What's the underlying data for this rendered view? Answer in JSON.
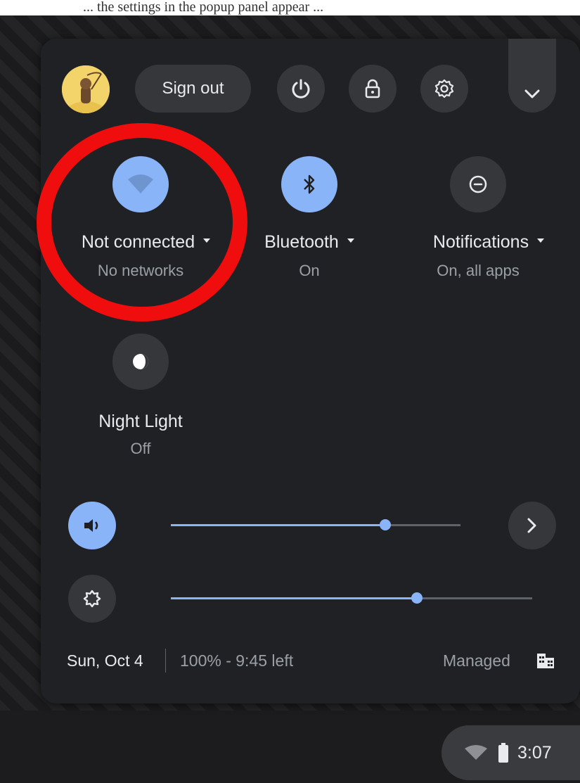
{
  "caption": "... the settings in the popup panel appear ...",
  "header": {
    "sign_out_label": "Sign out"
  },
  "tiles": {
    "network": {
      "label": "Not connected",
      "sub": "No networks",
      "active": true
    },
    "bluetooth": {
      "label": "Bluetooth",
      "sub": "On",
      "active": true
    },
    "notifications": {
      "label": "Notifications",
      "sub": "On, all apps",
      "active": false
    },
    "night_light": {
      "label": "Night Light",
      "sub": "Off",
      "active": false
    }
  },
  "sliders": {
    "volume": {
      "level": 0.74
    },
    "brightness": {
      "level": 0.68
    }
  },
  "footer": {
    "date": "Sun, Oct 4",
    "battery": "100% - 9:45 left",
    "managed": "Managed"
  },
  "tray": {
    "time": "3:07"
  },
  "colors": {
    "accent": "#8ab4f8",
    "panel": "#202124",
    "highlight_ring": "#ef0d0d"
  }
}
